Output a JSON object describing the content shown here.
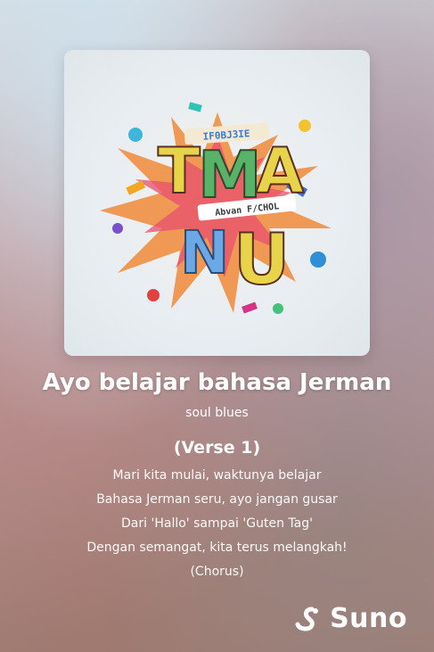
{
  "song": {
    "title": "Ayo belajar bahasa Jerman",
    "genre": "soul blues"
  },
  "cover": {
    "letters": [
      "T",
      "M",
      "A",
      "N",
      "U"
    ],
    "banner_top": "IF0BJ3IE",
    "banner_mid": "Abvan F/CHOL"
  },
  "lyrics": {
    "heading": "(Verse 1)",
    "lines": [
      "Mari kita mulai, waktunya belajar",
      "Bahasa Jerman seru, ayo jangan gusar",
      "Dari 'Hallo' sampai 'Guten Tag'",
      "Dengan semangat, kita terus melangkah!",
      "(Chorus)"
    ]
  },
  "brand": {
    "name": "Suno",
    "icon": "suno-logo-icon"
  }
}
